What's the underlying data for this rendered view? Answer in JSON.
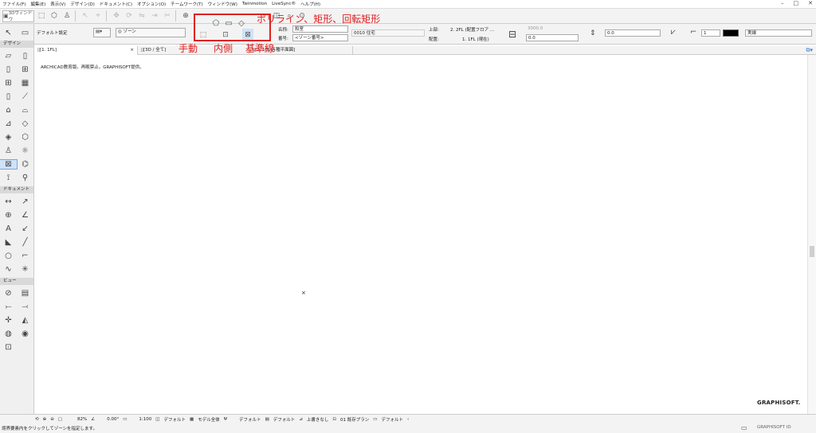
{
  "menu": [
    "ファイル(F)",
    "編集(E)",
    "表示(V)",
    "デザイン(D)",
    "ドキュメント(C)",
    "オプション(O)",
    "チームワーク(T)",
    "ウィンドウ(W)",
    "Twinmotion",
    "LiveSync®",
    "ヘルプ(H)"
  ],
  "toolbar": {
    "window3d": "3Dウィンドウ"
  },
  "infobox": {
    "default_setting": "デフォルト設定",
    "zone_tool": "ゾーン",
    "name_label": "名称:",
    "name_value": "和室",
    "number_label": "番号:",
    "number_value": "<ゾーン番号>",
    "category_value": "0010 住宅",
    "top_label": "上部:",
    "top_value": "2. 2FL (配置フロア ...",
    "bottom_label": "配置:",
    "bottom_value": "1. 1FL (現在)",
    "height_value": "3000.0",
    "offset_value": "0.0",
    "thickness_value": "0.0",
    "pen_value": "1",
    "fill_value": "実線"
  },
  "palette": {
    "design": "デザイン",
    "document": "ドキュメント",
    "view": "ビュー"
  },
  "tabs": [
    {
      "label": "[1. 1FL]",
      "active": true
    },
    {
      "label": "[3D / 全て]",
      "active": false
    },
    {
      "label": "[1. 1FL 各種平面図]",
      "active": false
    }
  ],
  "canvas": {
    "copyright": "ARCHICAD教育版。再販禁止。GRAPHISOFT提供。",
    "logo": "GRAPHISOFT."
  },
  "nav": {
    "zoom": "82%",
    "angle": "0.00°",
    "scale": "1:100",
    "layer": "デフォルト",
    "model": "モデル全体",
    "pen": "デフォルト",
    "display": "デフォルト",
    "override": "上書きなし",
    "renovation": "01 既存プラン",
    "structure": "デフォルト"
  },
  "status": {
    "message": "境界要素内をクリックしてゾーンを指定します。",
    "logo": "GRAPHISOFT ID"
  },
  "annotation": {
    "methods": "ポリライン、矩形、回転矩形",
    "manual": "手動",
    "inner": "内側",
    "reference": "基準線"
  }
}
